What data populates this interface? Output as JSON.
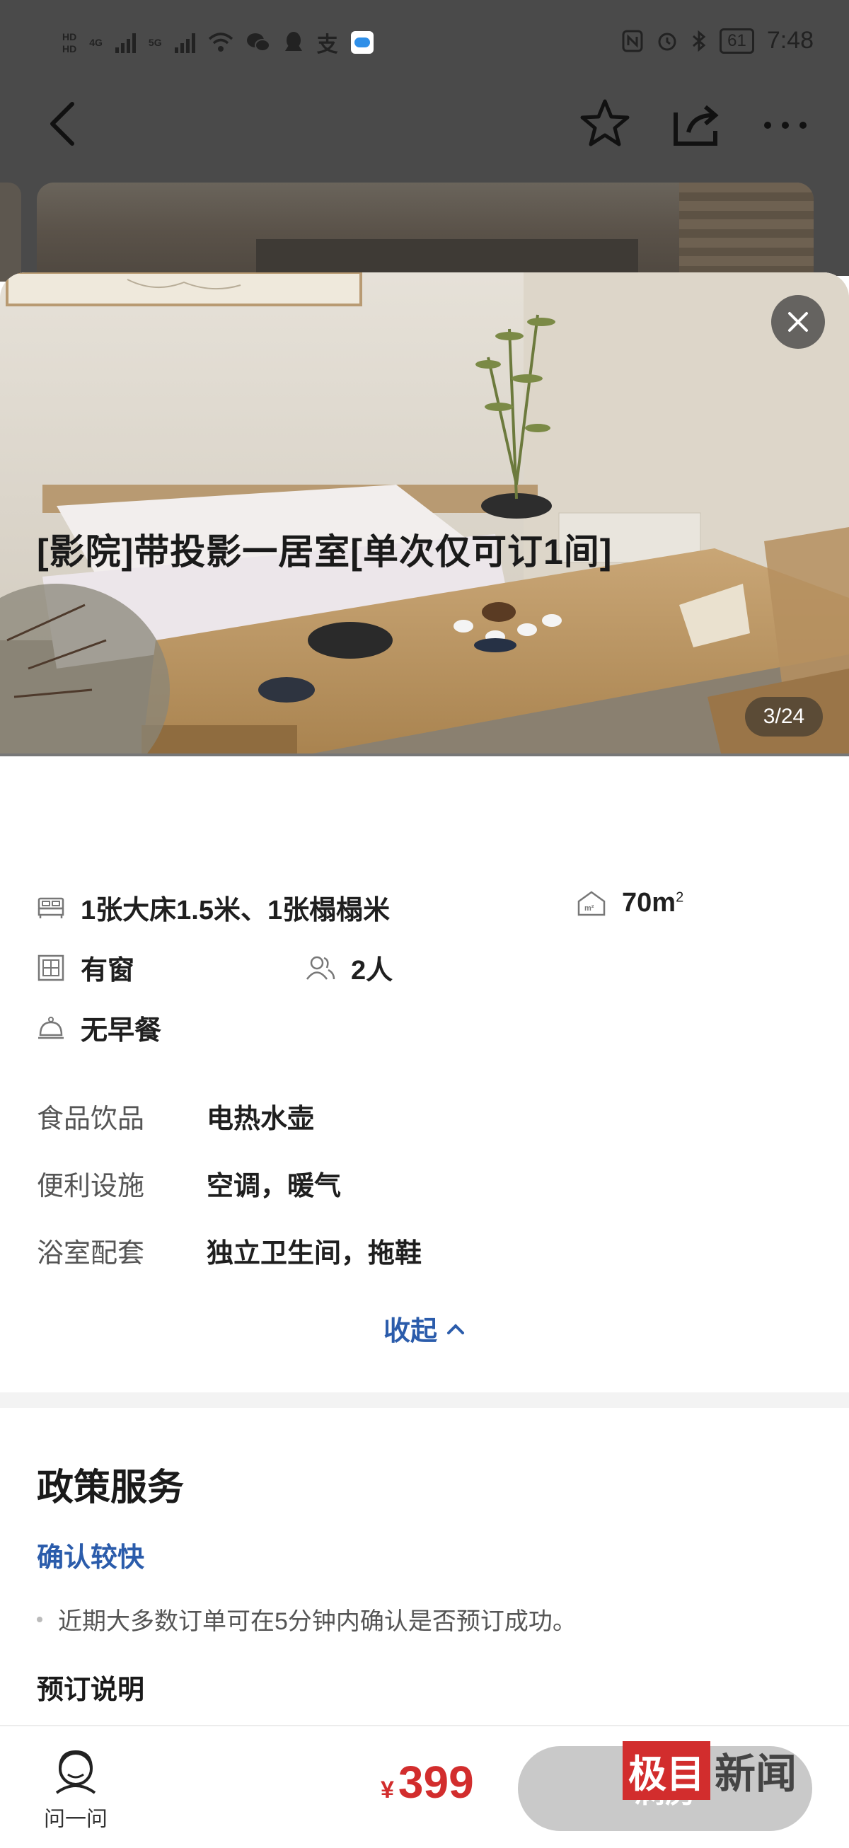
{
  "status_bar": {
    "network_badges": [
      "HD",
      "4G",
      "5G"
    ],
    "time": "7:48",
    "battery": "61",
    "app_icons": [
      "wifi-icon",
      "wechat-icon",
      "qq-icon",
      "alipay-icon",
      "cloud-icon"
    ],
    "status_icons": [
      "nfc-icon",
      "alarm-icon",
      "bluetooth-icon"
    ]
  },
  "nav": {
    "back_icon": "chevron-left-icon",
    "favorite_icon": "star-icon",
    "share_icon": "share-icon",
    "more_icon": "more-icon"
  },
  "gallery": {
    "counter": "3/24",
    "close_icon": "close-icon"
  },
  "room": {
    "title": "[影院]带投影一居室[单次仅可订1间]",
    "bed": "1张大床1.5米、1张榻榻米",
    "area_value": "70m",
    "area_sup": "2",
    "window": "有窗",
    "occupancy": "2人",
    "breakfast": "无早餐"
  },
  "amenities": [
    {
      "key": "食品饮品",
      "value": "电热水壶"
    },
    {
      "key": "便利设施",
      "value": "空调，暖气"
    },
    {
      "key": "浴室配套",
      "value": "独立卫生间，拖鞋"
    }
  ],
  "collapse_label": "收起",
  "policy": {
    "title": "政策服务",
    "confirm_title": "确认较快",
    "confirm_note": "近期大多数订单可在5分钟内确认是否预订成功。",
    "booking_title": "预订说明"
  },
  "bottom_bar": {
    "ask_label": "问一问",
    "currency": "¥",
    "price": "399",
    "book_label": "满房"
  },
  "watermark": {
    "box_text": "极目",
    "text": "新闻"
  },
  "colors": {
    "accent_blue": "#2b5cab",
    "price_red": "#d22d2d",
    "button_disabled": "#c9c9c9"
  }
}
